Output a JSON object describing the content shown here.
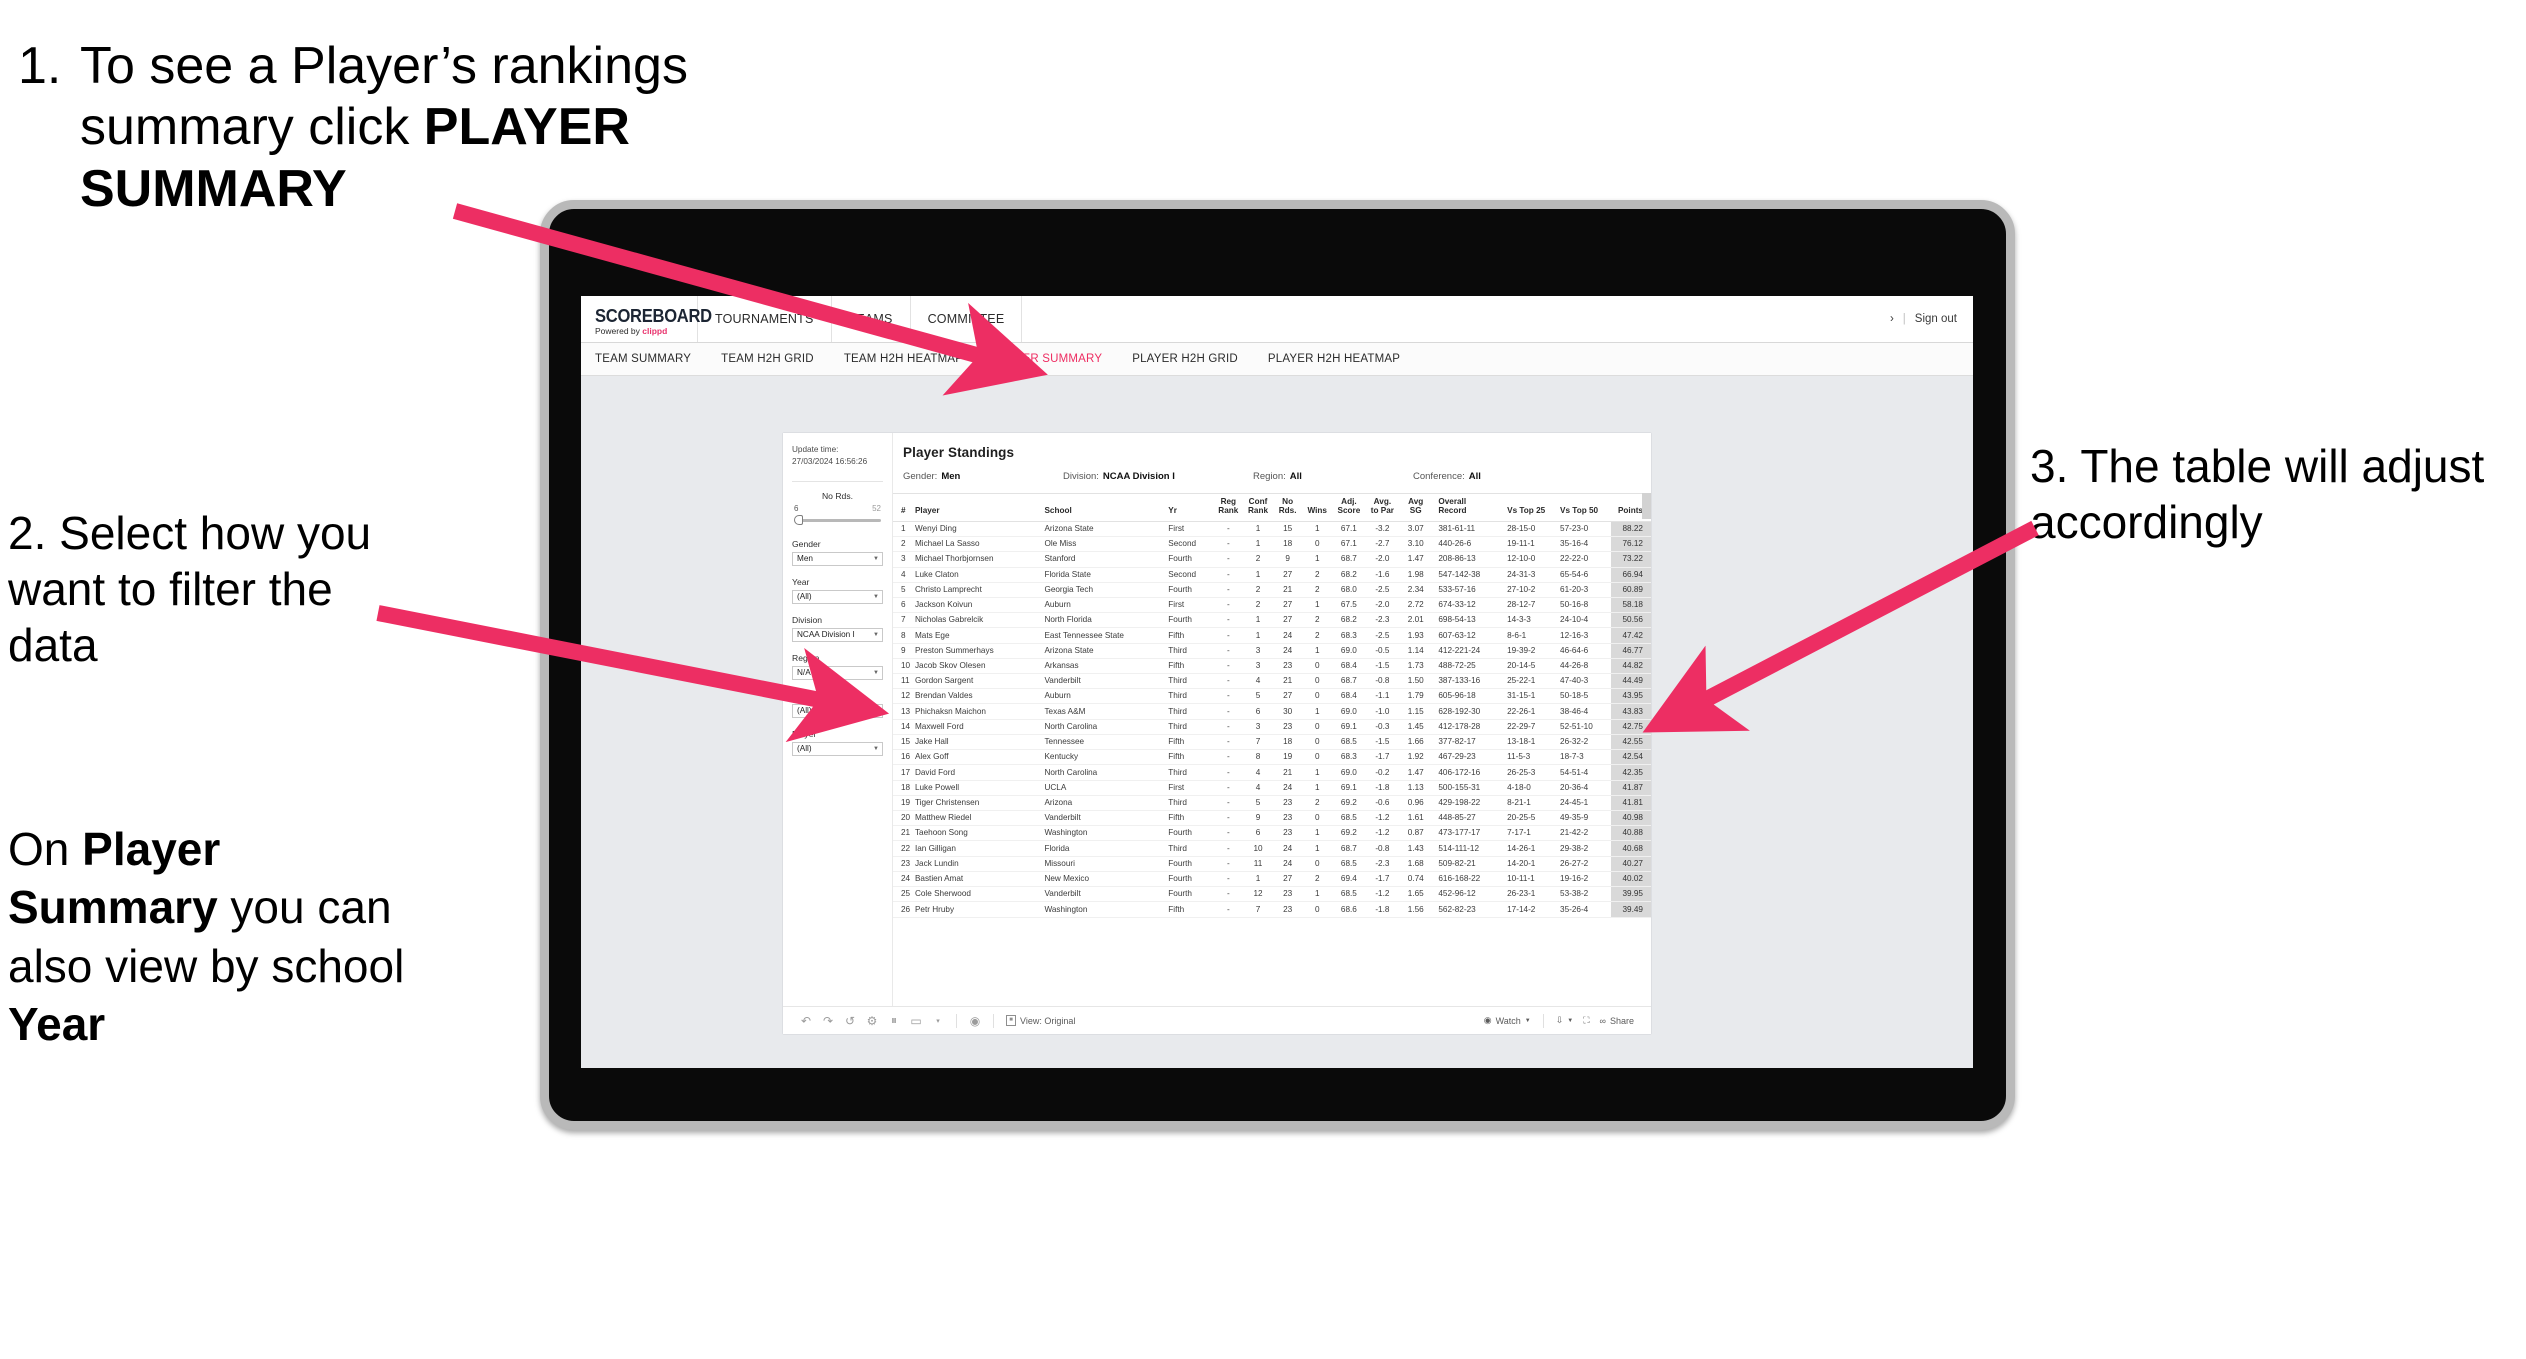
{
  "annotations": {
    "step1": {
      "number": "1.",
      "pre": "To see a Player’s rankings summary click ",
      "bold": "PLAYER SUMMARY"
    },
    "step2": {
      "text": "2. Select how you want to filter the data"
    },
    "step2b": {
      "pre": "On ",
      "bold1": "Player Summary",
      "mid": " you can also view by school ",
      "bold2": "Year"
    },
    "step3": {
      "text": "3. The table will adjust accordingly"
    },
    "arrow_color": "#ED2E63"
  },
  "app": {
    "brand": {
      "word": "SCOREBOARD",
      "powered_pre": "Powered by ",
      "powered_brand": "clippd"
    },
    "top_nav": [
      {
        "label": "TOURNAMENTS"
      },
      {
        "label": "TEAMS"
      },
      {
        "label": "COMMITTEE"
      }
    ],
    "account": {
      "user_glyph": "›",
      "separator": "|",
      "sign_out": "Sign out"
    },
    "sub_nav": [
      {
        "label": "TEAM SUMMARY",
        "active": false
      },
      {
        "label": "TEAM H2H GRID",
        "active": false
      },
      {
        "label": "TEAM H2H HEATMAP",
        "active": false
      },
      {
        "label": "PLAYER SUMMARY",
        "active": true
      },
      {
        "label": "PLAYER H2H GRID",
        "active": false
      },
      {
        "label": "PLAYER H2H HEATMAP",
        "active": false
      }
    ],
    "active_color": "#EE2D62"
  },
  "filters": {
    "update_label": "Update time:",
    "update_value": "27/03/2024 16:56:26",
    "slider": {
      "label": "No Rds.",
      "min": "6",
      "max": "52",
      "value": 6
    },
    "selects": [
      {
        "label": "Gender",
        "value": "Men"
      },
      {
        "label": "Year",
        "value": "(All)"
      },
      {
        "label": "Division",
        "value": "NCAA Division I"
      },
      {
        "label": "Region",
        "value": "N/A"
      },
      {
        "label": "Conference",
        "value": "(All)"
      },
      {
        "label": "Player",
        "value": "(All)"
      }
    ]
  },
  "viz": {
    "title": "Player Standings",
    "summary": [
      {
        "label": "Gender:",
        "value": "Men"
      },
      {
        "label": "Division:",
        "value": "NCAA Division I"
      },
      {
        "label": "Region:",
        "value": "All"
      },
      {
        "label": "Conference:",
        "value": "All"
      }
    ],
    "columns": [
      {
        "key": "rank",
        "line1": "#",
        "line2": ""
      },
      {
        "key": "player",
        "line1": "Player",
        "line2": ""
      },
      {
        "key": "school",
        "line1": "School",
        "line2": ""
      },
      {
        "key": "yr",
        "line1": "Yr",
        "line2": ""
      },
      {
        "key": "reg_rank",
        "line1": "Reg",
        "line2": "Rank"
      },
      {
        "key": "conf_rank",
        "line1": "Conf",
        "line2": "Rank"
      },
      {
        "key": "no_rds",
        "line1": "No",
        "line2": "Rds."
      },
      {
        "key": "wins",
        "line1": "",
        "line2": "Wins"
      },
      {
        "key": "adj_score",
        "line1": "Adj.",
        "line2": "Score"
      },
      {
        "key": "avg_to_par",
        "line1": "Avg.",
        "line2": "to Par"
      },
      {
        "key": "avg_sg",
        "line1": "Avg",
        "line2": "SG"
      },
      {
        "key": "overall_record",
        "line1": "Overall",
        "line2": "Record"
      },
      {
        "key": "vs_top25",
        "line1": "",
        "line2": "Vs Top 25"
      },
      {
        "key": "vs_top50",
        "line1": "",
        "line2": "Vs Top 50"
      },
      {
        "key": "points",
        "line1": "",
        "line2": "Points"
      }
    ],
    "rows": [
      [
        "1",
        "Wenyi Ding",
        "Arizona State",
        "First",
        "-",
        "1",
        "15",
        "1",
        "67.1",
        "-3.2",
        "3.07",
        "381-61-11",
        "28-15-0",
        "57-23-0",
        "88.22"
      ],
      [
        "2",
        "Michael La Sasso",
        "Ole Miss",
        "Second",
        "-",
        "1",
        "18",
        "0",
        "67.1",
        "-2.7",
        "3.10",
        "440-26-6",
        "19-11-1",
        "35-16-4",
        "76.12"
      ],
      [
        "3",
        "Michael Thorbjornsen",
        "Stanford",
        "Fourth",
        "-",
        "2",
        "9",
        "1",
        "68.7",
        "-2.0",
        "1.47",
        "208-86-13",
        "12-10-0",
        "22-22-0",
        "73.22"
      ],
      [
        "4",
        "Luke Claton",
        "Florida State",
        "Second",
        "-",
        "1",
        "27",
        "2",
        "68.2",
        "-1.6",
        "1.98",
        "547-142-38",
        "24-31-3",
        "65-54-6",
        "66.94"
      ],
      [
        "5",
        "Christo Lamprecht",
        "Georgia Tech",
        "Fourth",
        "-",
        "2",
        "21",
        "2",
        "68.0",
        "-2.5",
        "2.34",
        "533-57-16",
        "27-10-2",
        "61-20-3",
        "60.89"
      ],
      [
        "6",
        "Jackson Koivun",
        "Auburn",
        "First",
        "-",
        "2",
        "27",
        "1",
        "67.5",
        "-2.0",
        "2.72",
        "674-33-12",
        "28-12-7",
        "50-16-8",
        "58.18"
      ],
      [
        "7",
        "Nicholas Gabrelcik",
        "North Florida",
        "Fourth",
        "-",
        "1",
        "27",
        "2",
        "68.2",
        "-2.3",
        "2.01",
        "698-54-13",
        "14-3-3",
        "24-10-4",
        "50.56"
      ],
      [
        "8",
        "Mats Ege",
        "East Tennessee State",
        "Fifth",
        "-",
        "1",
        "24",
        "2",
        "68.3",
        "-2.5",
        "1.93",
        "607-63-12",
        "8-6-1",
        "12-16-3",
        "47.42"
      ],
      [
        "9",
        "Preston Summerhays",
        "Arizona State",
        "Third",
        "-",
        "3",
        "24",
        "1",
        "69.0",
        "-0.5",
        "1.14",
        "412-221-24",
        "19-39-2",
        "46-64-6",
        "46.77"
      ],
      [
        "10",
        "Jacob Skov Olesen",
        "Arkansas",
        "Fifth",
        "-",
        "3",
        "23",
        "0",
        "68.4",
        "-1.5",
        "1.73",
        "488-72-25",
        "20-14-5",
        "44-26-8",
        "44.82"
      ],
      [
        "11",
        "Gordon Sargent",
        "Vanderbilt",
        "Third",
        "-",
        "4",
        "21",
        "0",
        "68.7",
        "-0.8",
        "1.50",
        "387-133-16",
        "25-22-1",
        "47-40-3",
        "44.49"
      ],
      [
        "12",
        "Brendan Valdes",
        "Auburn",
        "Third",
        "-",
        "5",
        "27",
        "0",
        "68.4",
        "-1.1",
        "1.79",
        "605-96-18",
        "31-15-1",
        "50-18-5",
        "43.95"
      ],
      [
        "13",
        "Phichaksn Maichon",
        "Texas A&M",
        "Third",
        "-",
        "6",
        "30",
        "1",
        "69.0",
        "-1.0",
        "1.15",
        "628-192-30",
        "22-26-1",
        "38-46-4",
        "43.83"
      ],
      [
        "14",
        "Maxwell Ford",
        "North Carolina",
        "Third",
        "-",
        "3",
        "23",
        "0",
        "69.1",
        "-0.3",
        "1.45",
        "412-178-28",
        "22-29-7",
        "52-51-10",
        "42.75"
      ],
      [
        "15",
        "Jake Hall",
        "Tennessee",
        "Fifth",
        "-",
        "7",
        "18",
        "0",
        "68.5",
        "-1.5",
        "1.66",
        "377-82-17",
        "13-18-1",
        "26-32-2",
        "42.55"
      ],
      [
        "16",
        "Alex Goff",
        "Kentucky",
        "Fifth",
        "-",
        "8",
        "19",
        "0",
        "68.3",
        "-1.7",
        "1.92",
        "467-29-23",
        "11-5-3",
        "18-7-3",
        "42.54"
      ],
      [
        "17",
        "David Ford",
        "North Carolina",
        "Third",
        "-",
        "4",
        "21",
        "1",
        "69.0",
        "-0.2",
        "1.47",
        "406-172-16",
        "26-25-3",
        "54-51-4",
        "42.35"
      ],
      [
        "18",
        "Luke Powell",
        "UCLA",
        "First",
        "-",
        "4",
        "24",
        "1",
        "69.1",
        "-1.8",
        "1.13",
        "500-155-31",
        "4-18-0",
        "20-36-4",
        "41.87"
      ],
      [
        "19",
        "Tiger Christensen",
        "Arizona",
        "Third",
        "-",
        "5",
        "23",
        "2",
        "69.2",
        "-0.6",
        "0.96",
        "429-198-22",
        "8-21-1",
        "24-45-1",
        "41.81"
      ],
      [
        "20",
        "Matthew Riedel",
        "Vanderbilt",
        "Fifth",
        "-",
        "9",
        "23",
        "0",
        "68.5",
        "-1.2",
        "1.61",
        "448-85-27",
        "20-25-5",
        "49-35-9",
        "40.98"
      ],
      [
        "21",
        "Taehoon Song",
        "Washington",
        "Fourth",
        "-",
        "6",
        "23",
        "1",
        "69.2",
        "-1.2",
        "0.87",
        "473-177-17",
        "7-17-1",
        "21-42-2",
        "40.88"
      ],
      [
        "22",
        "Ian Gilligan",
        "Florida",
        "Third",
        "-",
        "10",
        "24",
        "1",
        "68.7",
        "-0.8",
        "1.43",
        "514-111-12",
        "14-26-1",
        "29-38-2",
        "40.68"
      ],
      [
        "23",
        "Jack Lundin",
        "Missouri",
        "Fourth",
        "-",
        "11",
        "24",
        "0",
        "68.5",
        "-2.3",
        "1.68",
        "509-82-21",
        "14-20-1",
        "26-27-2",
        "40.27"
      ],
      [
        "24",
        "Bastien Amat",
        "New Mexico",
        "Fourth",
        "-",
        "1",
        "27",
        "2",
        "69.4",
        "-1.7",
        "0.74",
        "616-168-22",
        "10-11-1",
        "19-16-2",
        "40.02"
      ],
      [
        "25",
        "Cole Sherwood",
        "Vanderbilt",
        "Fourth",
        "-",
        "12",
        "23",
        "1",
        "68.5",
        "-1.2",
        "1.65",
        "452-96-12",
        "26-23-1",
        "53-38-2",
        "39.95"
      ],
      [
        "26",
        "Petr Hruby",
        "Washington",
        "Fifth",
        "-",
        "7",
        "23",
        "0",
        "68.6",
        "-1.8",
        "1.56",
        "562-82-23",
        "17-14-2",
        "35-26-4",
        "39.49"
      ]
    ],
    "points_highlight_color": "#D9D9D9"
  },
  "toolbar": {
    "left_icons": [
      "undo-icon",
      "redo-icon",
      "revert-icon",
      "refresh-data-icon",
      "pause-updates-icon",
      "rectangle-select-icon",
      "select-dropdown-icon"
    ],
    "glyphs": [
      "↶",
      "↷",
      "↺",
      "↻",
      "⏸",
      "▭",
      "▾",
      "◔"
    ],
    "view_label": "View: Original",
    "watch_label": "Watch",
    "share_label": "Share",
    "download_caret": "▾",
    "fullscreen_icon": "fullscreen-icon"
  }
}
